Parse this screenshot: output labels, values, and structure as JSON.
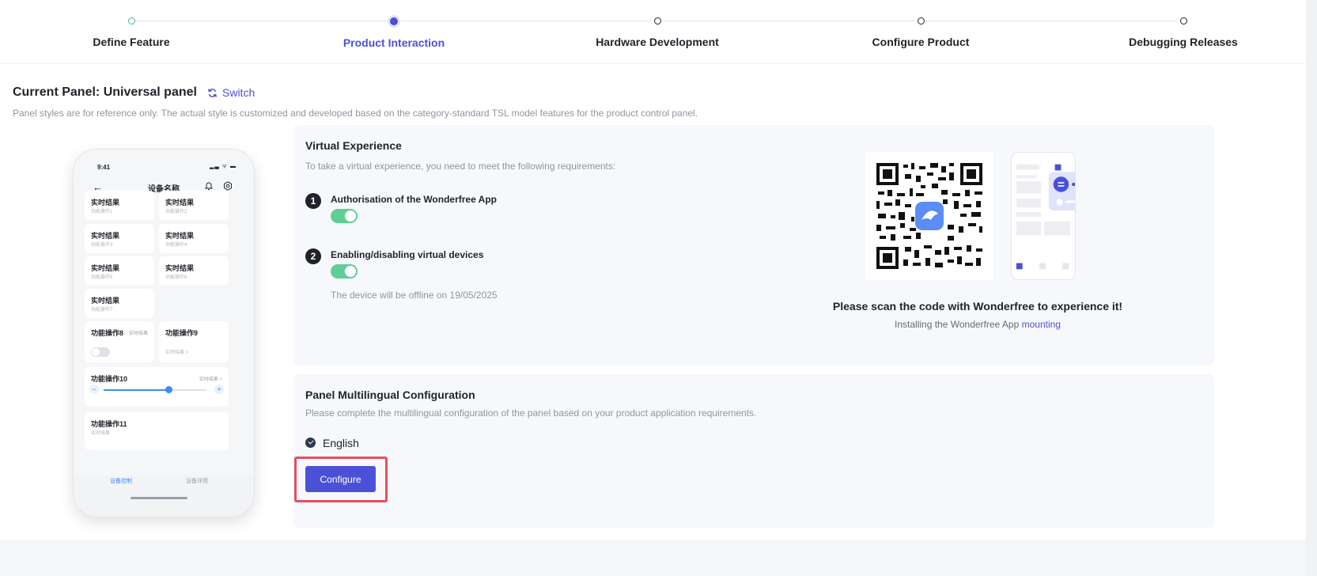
{
  "stepper": {
    "steps": [
      {
        "label": "Define Feature",
        "state": "done"
      },
      {
        "label": "Product Interaction",
        "state": "active"
      },
      {
        "label": "Hardware Development",
        "state": "todo"
      },
      {
        "label": "Configure Product",
        "state": "todo"
      },
      {
        "label": "Debugging Releases",
        "state": "todo"
      }
    ]
  },
  "header": {
    "title": "Current Panel: Universal panel",
    "switch_label": "Switch",
    "description": "Panel styles are for reference only. The actual style is customized and developed based on the category-standard TSL model features for the product control panel."
  },
  "phone": {
    "time": "9:41",
    "status_icons": "▂▃ ᯤ ▬",
    "title": "设备名称",
    "cards": [
      {
        "title": "实时结果",
        "sub": "功能操作1"
      },
      {
        "title": "实时结果",
        "sub": "功能操作2"
      },
      {
        "title": "实时结果",
        "sub": "功能操作3"
      },
      {
        "title": "实时结果",
        "sub": "功能操作4"
      },
      {
        "title": "实时结果",
        "sub": "功能操作5"
      },
      {
        "title": "实时结果",
        "sub": "功能操作6"
      },
      {
        "title": "实时结果",
        "sub": "功能操作7"
      }
    ],
    "op8": {
      "title": "功能操作8",
      "right": "实时结果"
    },
    "op9": {
      "title": "功能操作9",
      "sub": "实时结果 >"
    },
    "op10": {
      "title": "功能操作10",
      "right": "实时结果 >"
    },
    "op11": {
      "title": "功能操作11",
      "sub": "实时结果"
    },
    "tabs": [
      "设备控制",
      "设备详情"
    ]
  },
  "virtual": {
    "title": "Virtual Experience",
    "description": "To take a virtual experience, you need to meet the following requirements:",
    "requirements": [
      {
        "num": "1",
        "label": "Authorisation of the Wonderfree App",
        "enabled": true
      },
      {
        "num": "2",
        "label": "Enabling/disabling virtual devices",
        "enabled": true
      }
    ],
    "offline_note": "The device will be offline on 19/05/2025",
    "scan_title": "Please scan the code with Wonderfree to experience it!",
    "install_text": "Installing the Wonderfree App",
    "install_link": "mounting"
  },
  "multilingual": {
    "title": "Panel Multilingual Configuration",
    "description": "Please complete the multilingual configuration of the panel based on your product application requirements.",
    "language": "English",
    "configure_label": "Configure"
  },
  "colors": {
    "accent": "#4a51d6",
    "toggle_on": "#5fcf95",
    "highlight": "#e54e5b"
  }
}
